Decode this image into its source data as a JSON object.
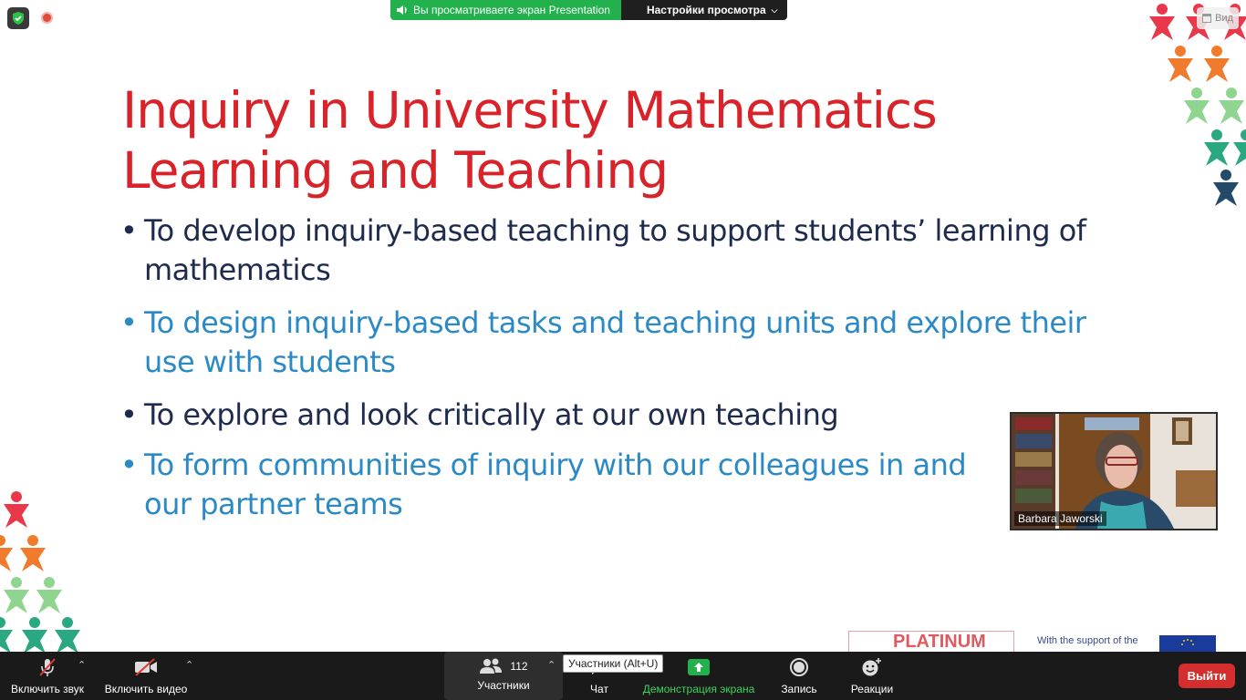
{
  "banner": {
    "sharing_text": "Вы просматриваете экран Presentation",
    "settings_label": "Настройки просмотра"
  },
  "view_button": {
    "label": "Вид"
  },
  "slide": {
    "title": "Inquiry in University Mathematics Learning and Teaching",
    "bullets": [
      {
        "text": "To develop inquiry-based teaching to support students’ learning of mathematics",
        "color": "#1f2b4d"
      },
      {
        "text": "To design inquiry-based tasks and teaching units and explore their use with students",
        "color": "#2b8ac6"
      },
      {
        "text": "To explore and look critically at our own teaching",
        "color": "#1f2b4d"
      },
      {
        "text": "To form communities of inquiry with our colleagues in and our partner teams",
        "color": "#2b8ac6"
      }
    ],
    "footer": {
      "logo_text": "PLATINUM",
      "support_text": "With the support of the"
    }
  },
  "video": {
    "participant_name": "Barbara Jaworski"
  },
  "toolbar": {
    "unmute_label": "Включить звук",
    "start_video_label": "Включить видео",
    "participants_label": "Участники",
    "participants_count": "112",
    "participants_tooltip": "Участники (Alt+U)",
    "chat_label": "Чат",
    "share_screen_label": "Демонстрация экрана",
    "record_label": "Запись",
    "reactions_label": "Реакции",
    "leave_label": "Выйти"
  },
  "colors": {
    "title_red": "#d9232a",
    "bullet_dark": "#1f2b4d",
    "bullet_blue": "#2b8ac6",
    "share_green": "#23b14d",
    "leave_red": "#d42e2e",
    "toolbar_bg": "#1a1a1a"
  },
  "icons": {
    "top_left": "shield-check-icon",
    "recording": "recording-dot-icon",
    "mic": "mic-muted-icon",
    "camera": "camera-off-icon",
    "participants": "people-icon",
    "chat": "chat-icon",
    "share": "share-arrow-icon",
    "record": "record-icon",
    "reactions": "smiley-plus-icon"
  }
}
